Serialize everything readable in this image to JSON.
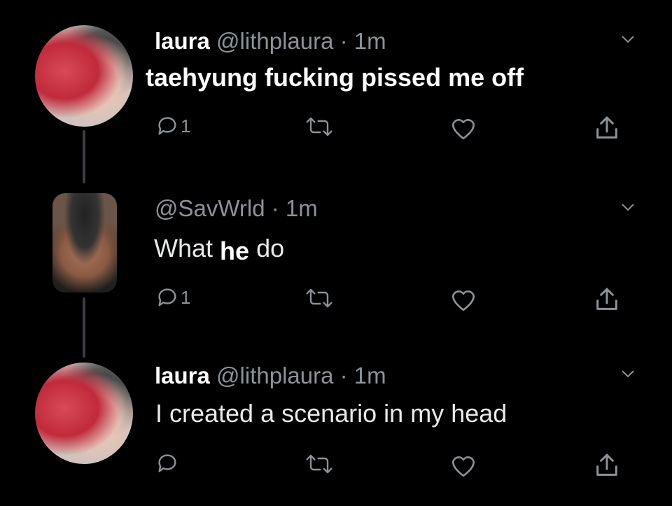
{
  "tweets": [
    {
      "name": "laura",
      "handle": "@lithplaura",
      "time": "· 1m",
      "text": "taehyung fucking pissed me off",
      "reply_count": "1"
    },
    {
      "name": "",
      "handle": "@SavWrld",
      "time": "· 1m",
      "text_a": "What",
      "text_b": "he",
      "text_c": "do",
      "reply_count": "1"
    },
    {
      "name": "laura",
      "handle": "@lithplaura",
      "time": "· 1m",
      "text": "I created a scenario in my head",
      "reply_count": ""
    }
  ],
  "icons": [
    "chevron-down-icon",
    "reply-icon",
    "retweet-icon",
    "like-icon",
    "share-icon"
  ],
  "colors": {
    "background": "#000000",
    "muted": "#8b9298",
    "text": "#e7e9ea",
    "thread_line": "#3a3d41"
  }
}
